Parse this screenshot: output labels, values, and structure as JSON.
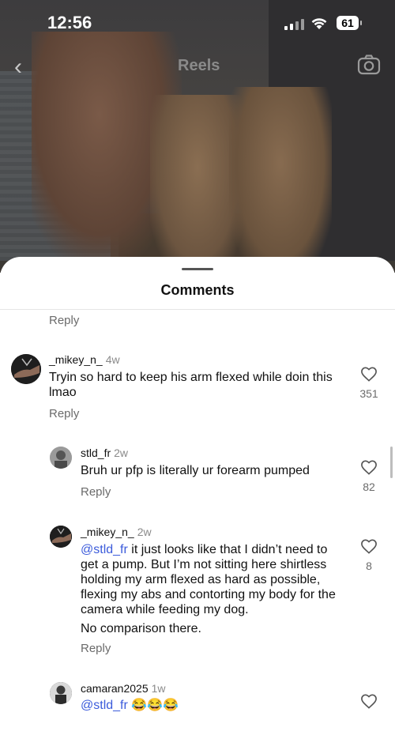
{
  "status_bar": {
    "time": "12:56",
    "battery": "61"
  },
  "top_bar": {
    "title": "Reels",
    "back_icon": "chevron-left-icon",
    "camera_icon": "camera-icon"
  },
  "sheet": {
    "title": "Comments",
    "top_reply": "Reply"
  },
  "comments": [
    {
      "username": "_mikey_n_",
      "age": "4w",
      "text": "Tryin so hard to keep his arm flexed while doin this lmao",
      "likes": "351",
      "reply": "Reply"
    },
    {
      "username": "stld_fr",
      "age": "2w",
      "text": "Bruh ur pfp is literally ur forearm pumped",
      "likes": "82",
      "reply": "Reply"
    },
    {
      "username": "_mikey_n_",
      "age": "2w",
      "mention": "@stld_fr",
      "text": " it just looks like that I didn’t need to get a pump. But I’m not sitting here shirtless holding my arm flexed as hard as possible, flexing my abs and contorting my body for the camera while feeding my dog.",
      "text2": "No comparison there.",
      "likes": "8",
      "reply": "Reply"
    },
    {
      "username": "camaran2025",
      "age": "1w",
      "mention": "@stld_fr",
      "text": " 😂😂😂"
    }
  ]
}
